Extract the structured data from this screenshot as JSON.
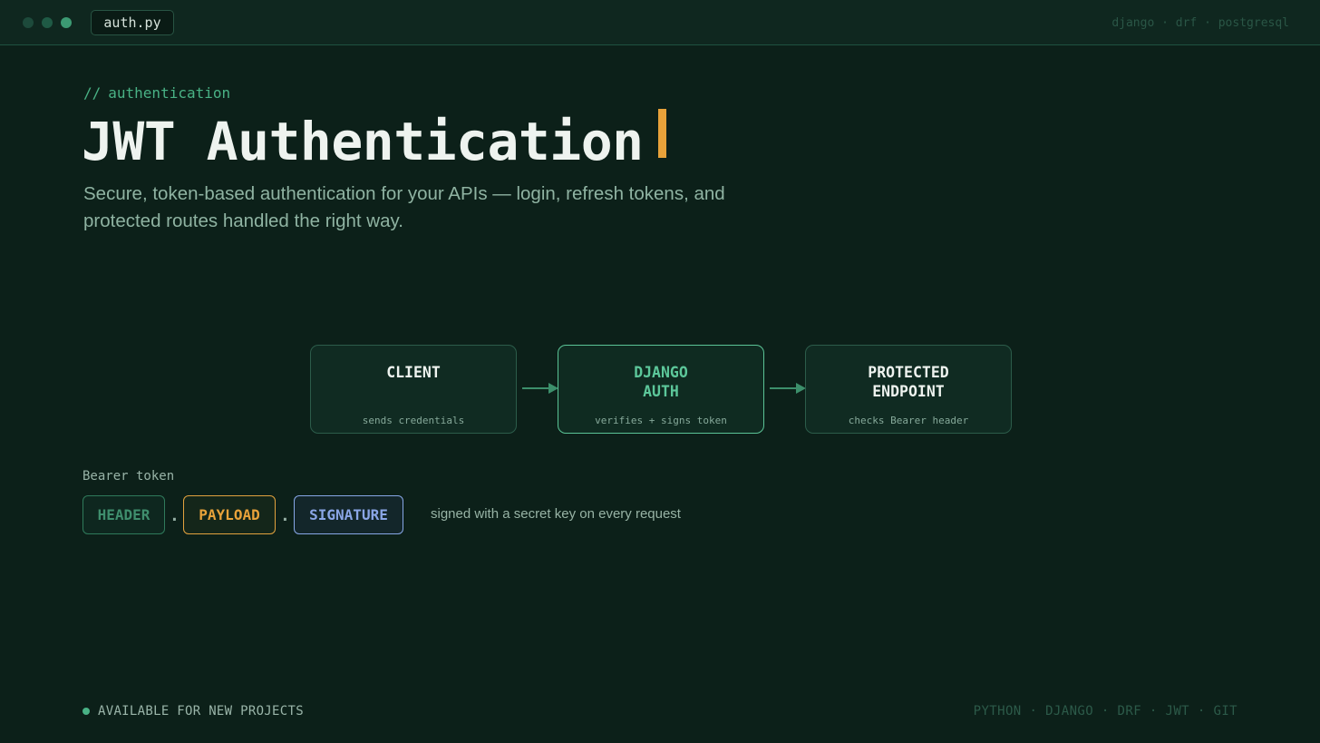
{
  "window": {
    "file_tab": "auth.py",
    "stack_meta": "django · drf · postgresql"
  },
  "hero": {
    "eyebrow_prefix": "//",
    "eyebrow": "authentication",
    "title": "JWT Authentication",
    "subtitle": "Secure, token-based authentication for your APIs — login, refresh tokens, and protected routes handled the right way."
  },
  "flow": {
    "nodes": [
      {
        "title": "CLIENT",
        "subtitle": "sends credentials"
      },
      {
        "title": "DJANGO\nAUTH",
        "subtitle": "verifies + signs token"
      },
      {
        "title": "PROTECTED\nENDPOINT",
        "subtitle": "checks Bearer header"
      }
    ]
  },
  "token": {
    "label": "Bearer token",
    "parts": [
      "HEADER",
      "PAYLOAD",
      "SIGNATURE"
    ],
    "separator": ".",
    "note": "signed with a secret key on every request"
  },
  "footer": {
    "status": "AVAILABLE FOR NEW PROJECTS",
    "skills": "PYTHON · DJANGO · DRF · JWT · GIT"
  },
  "colors": {
    "background": "#0c2019",
    "accent_green": "#49b285",
    "accent_orange": "#e8a23a",
    "accent_blue": "#8aa6e6"
  }
}
